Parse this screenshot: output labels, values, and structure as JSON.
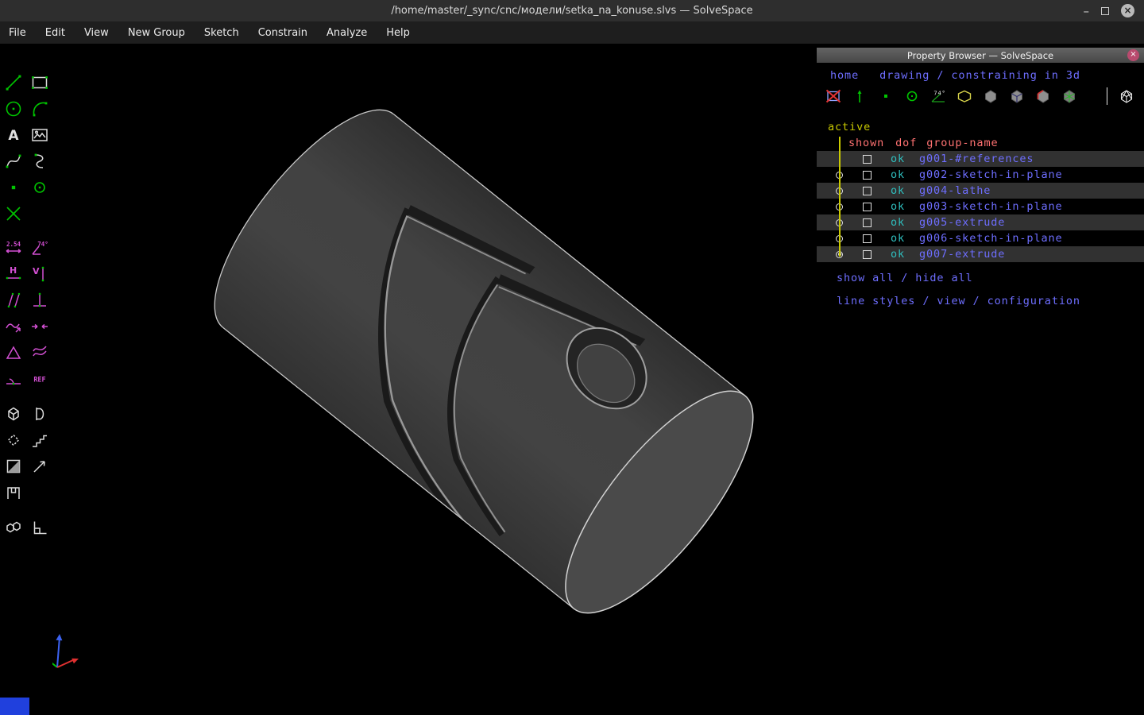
{
  "window": {
    "title": "/home/master/_sync/cnc/модели/setka_na_konuse.slvs — SolveSpace",
    "minimize_glyph": "–",
    "close_glyph": "×"
  },
  "menu": {
    "items": [
      "File",
      "Edit",
      "View",
      "New Group",
      "Sketch",
      "Constrain",
      "Analyze",
      "Help"
    ]
  },
  "toolbar": {
    "glyphs": {
      "text_tool": "A",
      "distance": "2.54",
      "angle": "74°",
      "horizontal": "H",
      "vertical": "V",
      "reference": "REF"
    }
  },
  "property_browser": {
    "title": "Property Browser — SolveSpace",
    "close_glyph": "×",
    "home_link": "home",
    "context": "drawing / constraining in 3d",
    "toolbar_angle": "74°",
    "active_label": "active",
    "columns": {
      "shown": "shown",
      "dof": "dof",
      "group_name": "group-name"
    },
    "rows": [
      {
        "name": "g001-#references",
        "dof": "ok"
      },
      {
        "name": "g002-sketch-in-plane",
        "dof": "ok"
      },
      {
        "name": "g004-lathe",
        "dof": "ok"
      },
      {
        "name": "g003-sketch-in-plane",
        "dof": "ok"
      },
      {
        "name": "g005-extrude",
        "dof": "ok"
      },
      {
        "name": "g006-sketch-in-plane",
        "dof": "ok"
      },
      {
        "name": "g007-extrude",
        "dof": "ok"
      }
    ],
    "links": {
      "show_hide": "show all / hide all",
      "config": "line styles / view / configuration"
    }
  },
  "colors": {
    "link": "#6e6eff",
    "ok": "#2fbfbf",
    "header": "#ff7272",
    "active": "#c9c900",
    "stripe": "#313131",
    "tool-green": "#00c400",
    "tool-magenta": "#d24fd2",
    "tool-white": "#dcdcdc"
  }
}
